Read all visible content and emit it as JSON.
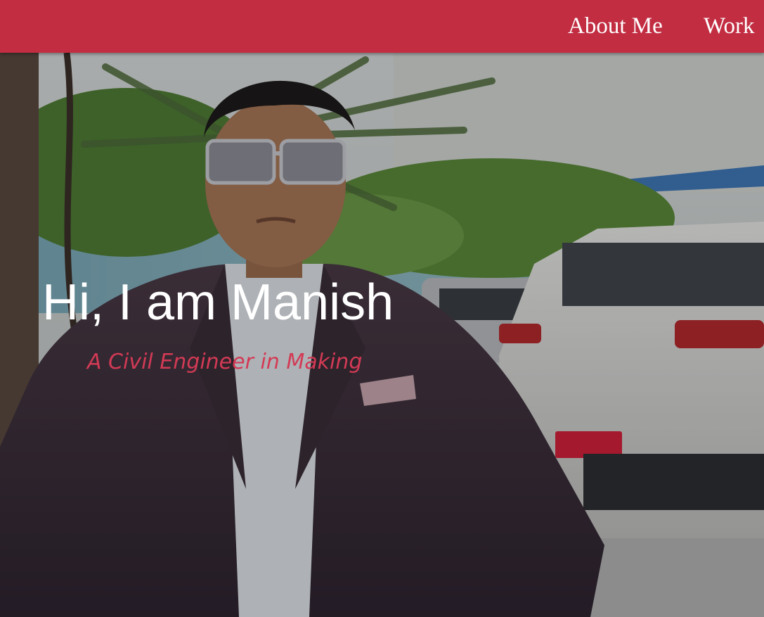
{
  "nav": {
    "links": [
      {
        "label": "About Me"
      },
      {
        "label": "Work"
      }
    ]
  },
  "hero": {
    "title": "Hi, I am Manish",
    "subtitle": "A Civil Engineer in Making",
    "photo_icon": "portrait-photo"
  },
  "colors": {
    "navbar": "#c22d42",
    "nav_text": "#ffffff",
    "title": "#ffffff",
    "subtitle": "#d33a55"
  }
}
